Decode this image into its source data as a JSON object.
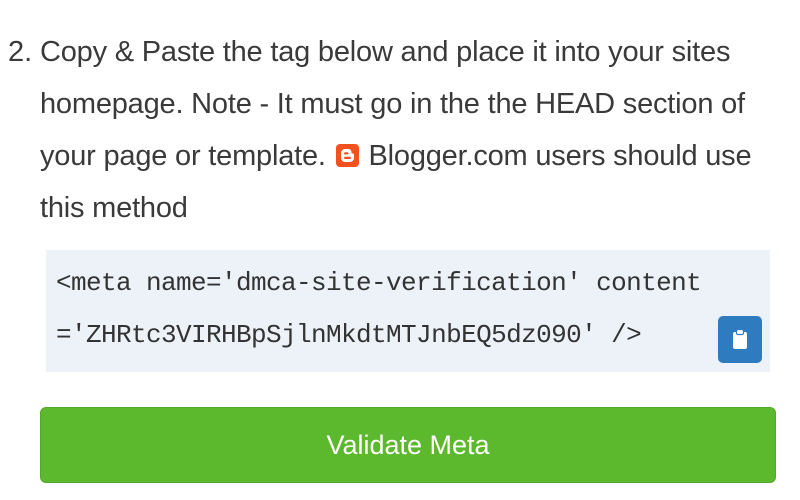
{
  "step": {
    "number": "2.",
    "text_before_icon": "Copy & Paste the tag below and place it into your sites homepage. Note - It must go in the the HEAD section of your page or template.",
    "icon": "blogger-icon",
    "text_after_icon": "Blogger.com users should use this method"
  },
  "code": {
    "line1": "<meta name='dmca-site-verification' content",
    "line2": "='ZHRtc3VIRHBpSjlnMkdtMTJnbEQ5dz090' />",
    "copy_icon": "clipboard-icon"
  },
  "validate": {
    "label": "Validate Meta"
  },
  "colors": {
    "text": "#3a3a3a",
    "code_background": "#ecf2f8",
    "copy_button": "#2f7bbf",
    "validate_button": "#5cb82d",
    "blogger_icon": "#f4511e"
  }
}
